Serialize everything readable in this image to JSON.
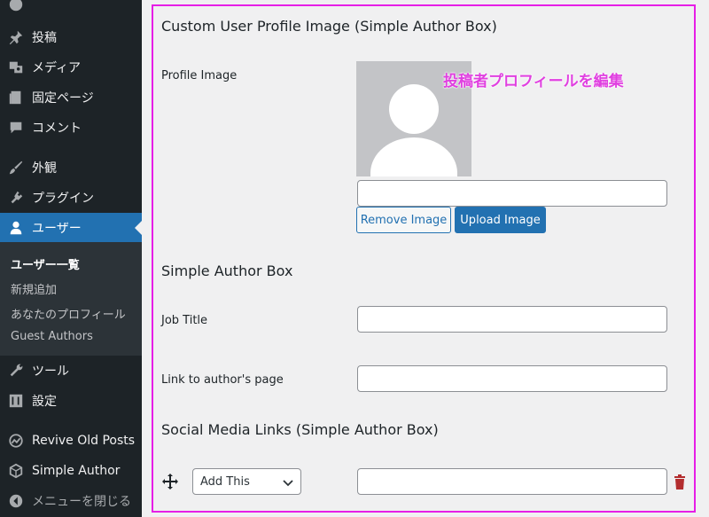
{
  "sidebar": {
    "items": [
      {
        "label": "投稿"
      },
      {
        "label": "メディア"
      },
      {
        "label": "固定ページ"
      },
      {
        "label": "コメント"
      },
      {
        "label": "外観"
      },
      {
        "label": "プラグイン"
      },
      {
        "label": "ユーザー"
      },
      {
        "label": "ツール"
      },
      {
        "label": "設定"
      },
      {
        "label": "Revive Old Posts"
      },
      {
        "label": "Simple Author"
      },
      {
        "label": "メニューを閉じる"
      }
    ],
    "submenu": [
      {
        "label": "ユーザー一覧"
      },
      {
        "label": "新規追加"
      },
      {
        "label": "あなたのプロフィール"
      },
      {
        "label": "Guest Authors"
      }
    ],
    "active_color": "#2271b1"
  },
  "main": {
    "profile_image_section_title": "Custom User Profile Image (Simple Author Box)",
    "profile_image_label": "Profile Image",
    "profile_image_url": "",
    "annotation": "投稿者プロフィールを編集",
    "remove_image_label": "Remove Image",
    "upload_image_label": "Upload Image",
    "author_box_title": "Simple Author Box",
    "job_title_label": "Job Title",
    "job_title_value": "",
    "author_link_label": "Link to author's page",
    "author_link_value": "",
    "social_title": "Social Media Links (Simple Author Box)",
    "social_select_value": "Add This",
    "social_url_value": "",
    "highlight_color": "#e61ee6"
  }
}
